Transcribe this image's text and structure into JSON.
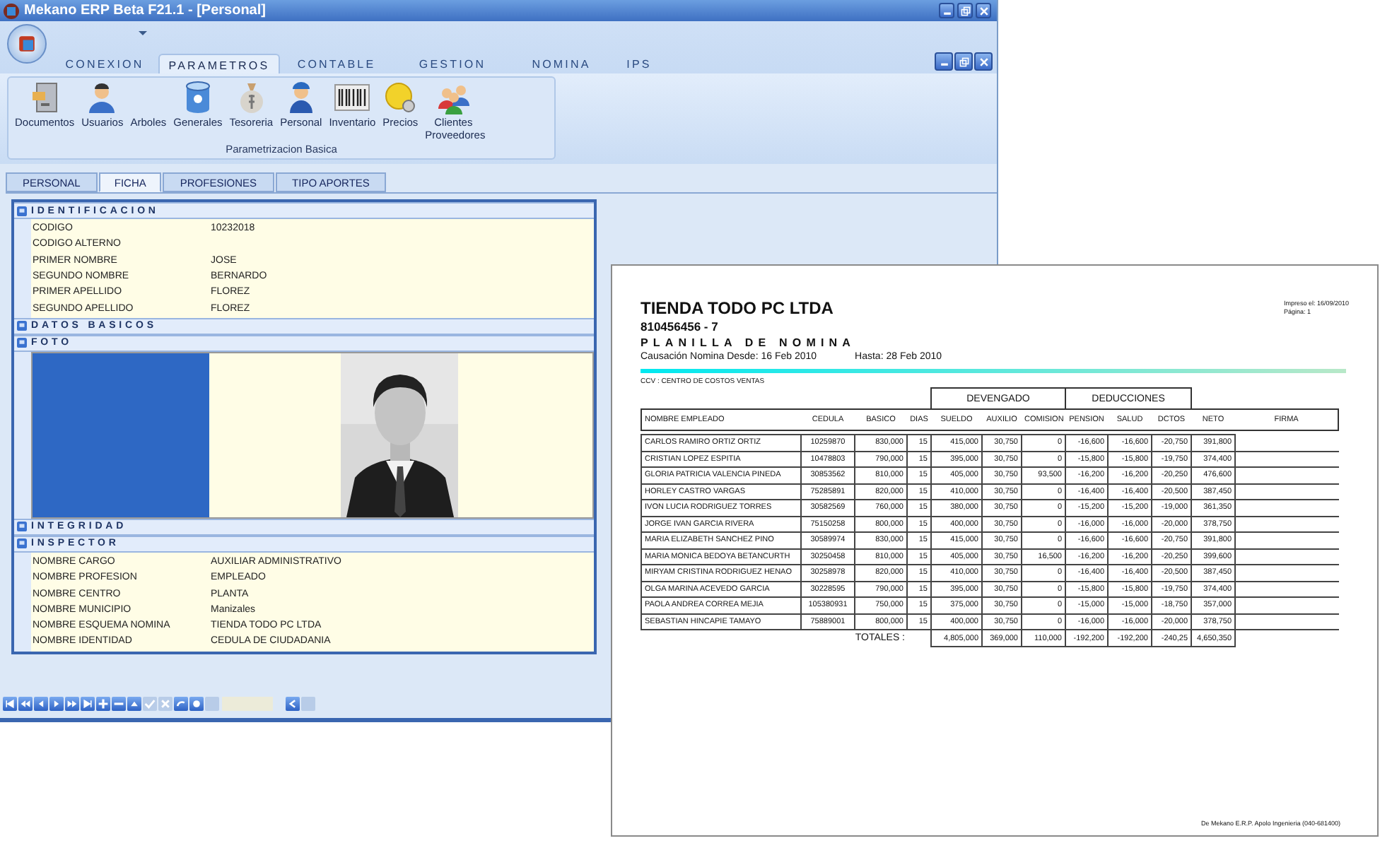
{
  "window": {
    "title": "Mekano ERP  Beta F21.1 - [Personal]"
  },
  "ribbon": {
    "tabs": [
      {
        "label": "CONEXION",
        "selected": false
      },
      {
        "label": "PARAMETROS",
        "selected": true
      },
      {
        "label": "CONTABLE",
        "selected": false
      },
      {
        "label": "GESTION",
        "selected": false
      },
      {
        "label": "NOMINA",
        "selected": false
      },
      {
        "label": "IPS",
        "selected": false
      }
    ],
    "buttons": [
      {
        "label": "Documentos",
        "kind": "cabinet"
      },
      {
        "label": "Usuarios",
        "kind": "user"
      },
      {
        "label": "Arboles",
        "kind": "none"
      },
      {
        "label": "Generales",
        "kind": "database"
      },
      {
        "label": "Tesoreria",
        "kind": "bag"
      },
      {
        "label": "Personal",
        "kind": "worker"
      },
      {
        "label": "Inventario",
        "kind": "barcode"
      },
      {
        "label": "Precios",
        "kind": "coin"
      },
      {
        "label": "Clientes Proveedores",
        "kind": "group"
      }
    ],
    "group_label": "Parametrizacion Basica"
  },
  "document_tabs": [
    {
      "label": "PERSONAL",
      "selected": false
    },
    {
      "label": "FICHA",
      "selected": true
    },
    {
      "label": "PROFESIONES",
      "selected": false
    },
    {
      "label": "TIPO APORTES",
      "selected": false
    }
  ],
  "sections": [
    {
      "title": "IDENTIFICACION",
      "kind": "fields",
      "fields": [
        {
          "label": "CODIGO",
          "value": "10232018"
        },
        {
          "label": "CODIGO ALTERNO"
        },
        {
          "label": "PRIMER NOMBRE",
          "value": "JOSE"
        },
        {
          "label": "SEGUNDO NOMBRE",
          "value": "BERNARDO"
        },
        {
          "label": "PRIMER APELLIDO",
          "value": "FLOREZ"
        },
        {
          "label": "SEGUNDO APELLIDO",
          "value": "FLOREZ"
        }
      ]
    },
    {
      "title": "DATOS BASICOS",
      "kind": "collapsed"
    },
    {
      "title": "FOTO"
    },
    {
      "title": "INTEGRIDAD",
      "kind": "collapsed"
    },
    {
      "title": "INSPECTOR",
      "kind": "fields",
      "fields": [
        {
          "label": "NOMBRE CARGO",
          "value": "AUXILIAR ADMINISTRATIVO"
        },
        {
          "label": "NOMBRE PROFESION",
          "value": "EMPLEADO"
        },
        {
          "label": "NOMBRE CENTRO",
          "value": "PLANTA"
        },
        {
          "label": "NOMBRE MUNICIPIO",
          "value": "Manizales"
        },
        {
          "label": "NOMBRE ESQUEMA NOMINA",
          "value": "TIENDA  TODO PC  LTDA"
        },
        {
          "label": "NOMBRE IDENTIDAD",
          "value": "CEDULA DE CIUDADANIA"
        }
      ]
    }
  ],
  "nav_buttons": [
    {
      "kind": "first",
      "disabled": false
    },
    {
      "kind": "prev-page",
      "disabled": false
    },
    {
      "kind": "prev",
      "disabled": false
    },
    {
      "kind": "next",
      "disabled": false
    },
    {
      "kind": "next-page",
      "disabled": false
    },
    {
      "kind": "last",
      "disabled": false
    },
    {
      "kind": "add",
      "disabled": false
    },
    {
      "kind": "remove",
      "disabled": false
    },
    {
      "kind": "up",
      "disabled": false
    },
    {
      "kind": "check",
      "disabled": true
    },
    {
      "kind": "cancel",
      "disabled": true
    },
    {
      "kind": "refresh",
      "disabled": false
    },
    {
      "kind": "record",
      "disabled": false
    },
    {
      "kind": "blank",
      "disabled": true
    }
  ],
  "report": {
    "company": "TIENDA TODO PC LTDA",
    "nit": "810456456 - 7",
    "title": "PLANILLA DE NOMINA",
    "period_from": "Causación Nomina  Desde:  16 Feb 2010",
    "period_to": "Hasta:  28 Feb 2010",
    "printed": "Impreso el: 16/09/2010",
    "page": "Página: 1",
    "cost_center": "CCV  :  CENTRO DE COSTOS VENTAS",
    "group_headers": [
      "DEVENGADO",
      "DEDUCCIONES"
    ],
    "columns": [
      "NOMBRE EMPLEADO",
      "CEDULA",
      "BASICO",
      "DIAS",
      "SUELDO",
      "AUXILIO",
      "COMISION",
      "PENSION",
      "SALUD",
      "DCTOS",
      "NETO",
      "FIRMA"
    ],
    "rows": [
      [
        "CARLOS RAMIRO ORTIZ ORTIZ",
        "10259870",
        "830,000",
        "15",
        "415,000",
        "30,750",
        "0",
        "-16,600",
        "-16,600",
        "-20,750",
        "391,800"
      ],
      [
        "CRISTIAN  LOPEZ ESPITIA",
        "10478803",
        "790,000",
        "15",
        "395,000",
        "30,750",
        "0",
        "-15,800",
        "-15,800",
        "-19,750",
        "374,400"
      ],
      [
        "GLORIA PATRICIA VALENCIA PINEDA",
        "30853562",
        "810,000",
        "15",
        "405,000",
        "30,750",
        "93,500",
        "-16,200",
        "-16,200",
        "-20,250",
        "476,600"
      ],
      [
        "HORLEY  CASTRO VARGAS",
        "75285891",
        "820,000",
        "15",
        "410,000",
        "30,750",
        "0",
        "-16,400",
        "-16,400",
        "-20,500",
        "387,450"
      ],
      [
        "IVON LUCIA RODRIGUEZ TORRES",
        "30582569",
        "760,000",
        "15",
        "380,000",
        "30,750",
        "0",
        "-15,200",
        "-15,200",
        "-19,000",
        "361,350"
      ],
      [
        "JORGE IVAN GARCIA RIVERA",
        "75150258",
        "800,000",
        "15",
        "400,000",
        "30,750",
        "0",
        "-16,000",
        "-16,000",
        "-20,000",
        "378,750"
      ],
      [
        "MARIA ELIZABETH SANCHEZ PINO",
        "30589974",
        "830,000",
        "15",
        "415,000",
        "30,750",
        "0",
        "-16,600",
        "-16,600",
        "-20,750",
        "391,800"
      ],
      [
        "MARIA MONICA BEDOYA BETANCURTH",
        "30250458",
        "810,000",
        "15",
        "405,000",
        "30,750",
        "16,500",
        "-16,200",
        "-16,200",
        "-20,250",
        "399,600"
      ],
      [
        "MIRYAM CRISTINA RODRIGUEZ HENAO",
        "30258978",
        "820,000",
        "15",
        "410,000",
        "30,750",
        "0",
        "-16,400",
        "-16,400",
        "-20,500",
        "387,450"
      ],
      [
        "OLGA MARINA ACEVEDO GARCIA",
        "30228595",
        "790,000",
        "15",
        "395,000",
        "30,750",
        "0",
        "-15,800",
        "-15,800",
        "-19,750",
        "374,400"
      ],
      [
        "PAOLA ANDREA CORREA MEJIA",
        "105380931",
        "750,000",
        "15",
        "375,000",
        "30,750",
        "0",
        "-15,000",
        "-15,000",
        "-18,750",
        "357,000"
      ],
      [
        "SEBASTIAN  HINCAPIE TAMAYO",
        "75889001",
        "800,000",
        "15",
        "400,000",
        "30,750",
        "0",
        "-16,000",
        "-16,000",
        "-20,000",
        "378,750"
      ]
    ],
    "totals_label": "TOTALES :",
    "totals": [
      "4,805,000",
      "369,000",
      "110,000",
      "-192,200",
      "-192,200",
      "-240,25",
      "4,650,350"
    ],
    "footer": "De Mekano E.R.P. Apolo Ingenieria (040-681400)"
  }
}
